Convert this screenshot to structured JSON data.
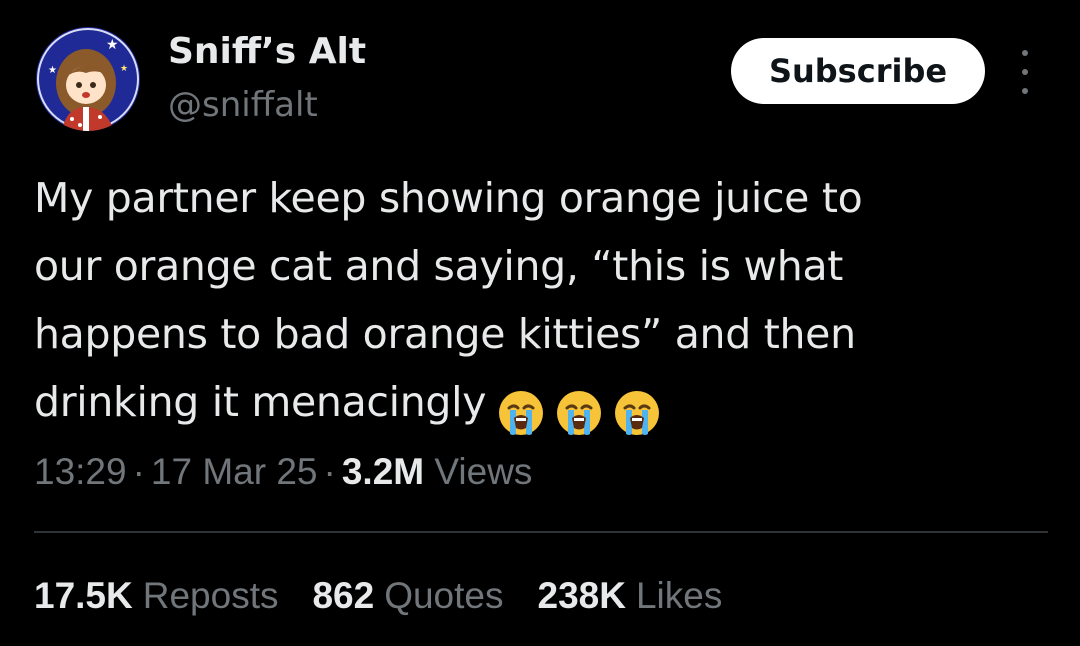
{
  "author": {
    "display_name": "Sniff’s Alt",
    "handle": "@sniffalt",
    "avatar_icon": "avatar-image"
  },
  "actions": {
    "subscribe_label": "Subscribe",
    "more_icon": "more-vertical-icon"
  },
  "tweet": {
    "lines": [
      "My partner keep showing orange juice to",
      "our orange cat and saying, “this is what",
      "happens to bad orange kitties” and then",
      "drinking it menacingly"
    ],
    "emojis": [
      "loudly-crying-face-icon",
      "loudly-crying-face-icon",
      "loudly-crying-face-icon"
    ]
  },
  "meta": {
    "time": "13:29",
    "date": "17 Mar 25",
    "separator": "·",
    "views_count": "3.2M",
    "views_label": "Views"
  },
  "stats": {
    "reposts_count": "17.5K",
    "reposts_label": "Reposts",
    "quotes_count": "862",
    "quotes_label": "Quotes",
    "likes_count": "238K",
    "likes_label": "Likes"
  },
  "colors": {
    "background": "#000000",
    "text_primary": "#e7e9ea",
    "text_secondary": "#71767b",
    "divider": "#2f3336",
    "button_bg": "#ffffff"
  }
}
